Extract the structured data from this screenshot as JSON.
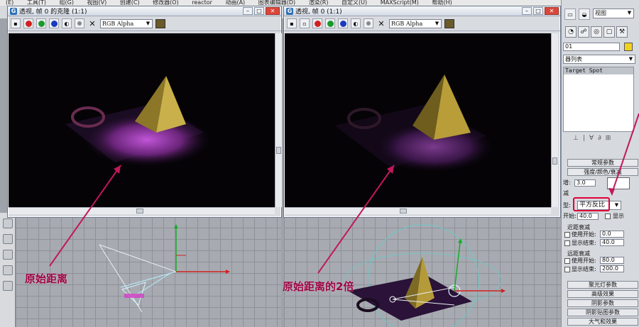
{
  "menubar": [
    "(E)",
    "工具(T)",
    "组(G)",
    "视图(V)",
    "创建(C)",
    "修改器(O)",
    "reactor",
    "动画(A)",
    "图表编辑器(D)",
    "渲染(R)",
    "自定义(U)",
    "MAXScript(M)",
    "帮助(H)"
  ],
  "render_windows": [
    {
      "title": "透视, 帧 0 的克隆 (1:1)",
      "channel": "RGB Alpha"
    },
    {
      "title": "透视, 帧 0 (1:1)",
      "channel": "RGB Alpha"
    }
  ],
  "annotations": {
    "left": "原始距离",
    "right": "原始距离的2倍"
  },
  "panel": {
    "view_dropdown": "视图",
    "object_name": "01",
    "modifier_list": "器列表",
    "stack_item": "Target Spot",
    "rollouts": {
      "general": "常规参数",
      "intensity": "强度/颜色/衰减",
      "multiplier_label": "增:",
      "multiplier_value": "3.0",
      "decay_label": "减",
      "type_label": "型:",
      "type_value": "平方反比",
      "start_label": "开始:",
      "start_value": "40.0",
      "show_label": "显示",
      "near_atten": "近距衰减",
      "near_use": "使用",
      "near_start_label": "开始:",
      "near_start_value": "0.0",
      "near_show": "显示",
      "near_end_label": "结束:",
      "near_end_value": "40.0",
      "far_atten": "远距衰减",
      "far_use": "使用",
      "far_start_label": "开始:",
      "far_start_value": "80.0",
      "far_show": "显示",
      "far_end_label": "结束:",
      "far_end_value": "200.0",
      "spotlight": "聚光灯参数",
      "advanced": "高级效果",
      "shadow": "阴影参数",
      "shadow_map": "阴影贴图参数",
      "atmosphere": "大气和效果"
    }
  },
  "colors": {
    "accent_annotation": "#9a0040",
    "highlight_box": "#e0003a",
    "render_bg": "#050306"
  }
}
